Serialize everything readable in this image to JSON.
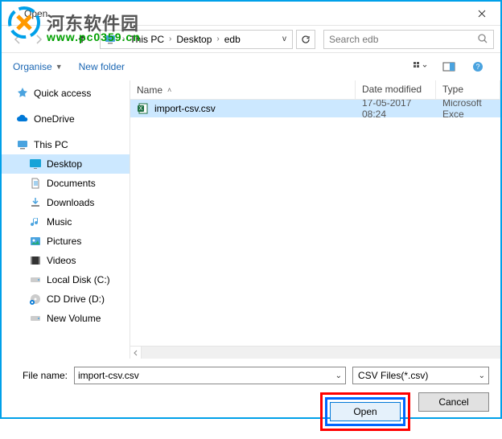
{
  "title": "Open",
  "watermark": {
    "text": "河东软件园",
    "url": "www.pc0359.cn"
  },
  "breadcrumb": {
    "items": [
      "This PC",
      "Desktop",
      "edb"
    ]
  },
  "search": {
    "placeholder": "Search edb"
  },
  "toolbar": {
    "organise": "Organise",
    "new_folder": "New folder"
  },
  "tree": {
    "quick_access": "Quick access",
    "onedrive": "OneDrive",
    "this_pc": "This PC",
    "desktop": "Desktop",
    "documents": "Documents",
    "downloads": "Downloads",
    "music": "Music",
    "pictures": "Pictures",
    "videos": "Videos",
    "local_c": "Local Disk (C:)",
    "cd_d": "CD Drive (D:)",
    "new_volume": "New Volume"
  },
  "columns": {
    "name": "Name",
    "date": "Date modified",
    "type": "Type"
  },
  "files": [
    {
      "name": "import-csv.csv",
      "date": "17-05-2017 08:24",
      "type": "Microsoft Exce"
    }
  ],
  "footer": {
    "file_label": "File name:",
    "file_value": "import-csv.csv",
    "filter": "CSV Files(*.csv)",
    "open": "Open",
    "cancel": "Cancel"
  }
}
